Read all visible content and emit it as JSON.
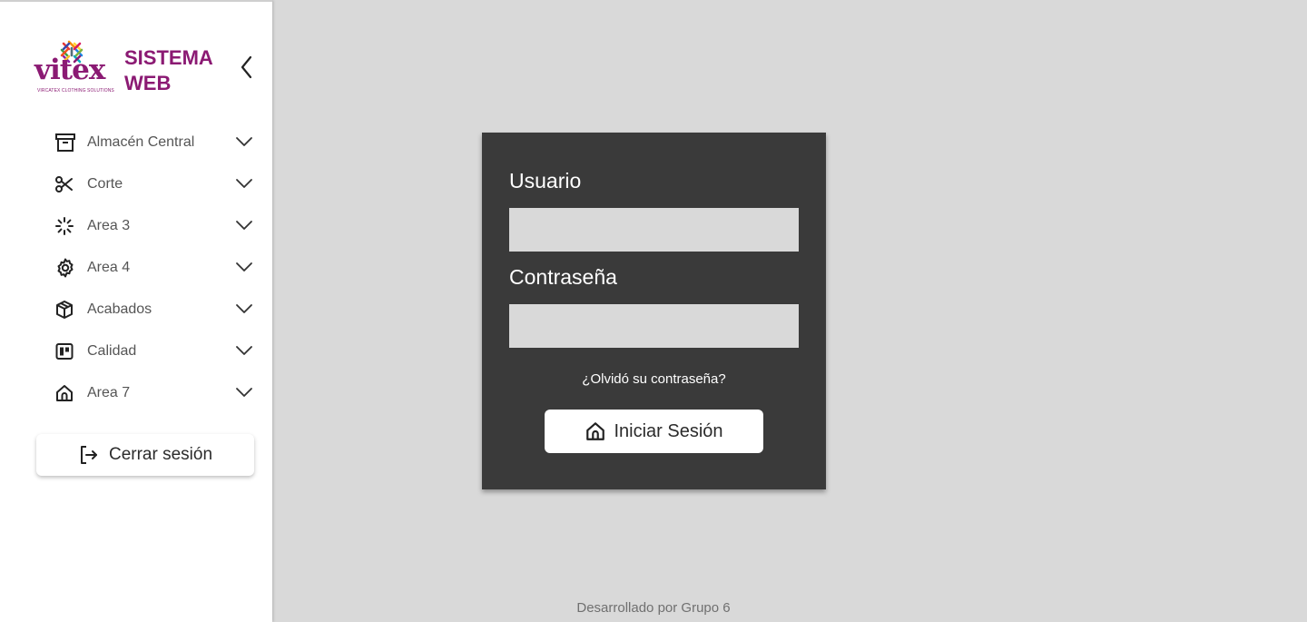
{
  "sidebar": {
    "brand": {
      "word": "vitex",
      "tagline": "VIRCATEX CLOTHING SOLUTIONS"
    },
    "title": "SISTEMA WEB",
    "collapse_icon": "chevron-left-icon",
    "items": [
      {
        "label": "Almacén Central",
        "icon": "archive-icon"
      },
      {
        "label": "Corte",
        "icon": "scissors-icon"
      },
      {
        "label": "Area 3",
        "icon": "loader-icon"
      },
      {
        "label": "Area 4",
        "icon": "gear-icon"
      },
      {
        "label": "Acabados",
        "icon": "package-icon"
      },
      {
        "label": "Calidad",
        "icon": "board-icon"
      },
      {
        "label": "Area 7",
        "icon": "home-icon"
      }
    ],
    "logout_label": "Cerrar sesión"
  },
  "login": {
    "user_label": "Usuario",
    "user_value": "",
    "password_label": "Contraseña",
    "password_value": "",
    "forgot_label": "¿Olvidó su contraseña?",
    "submit_label": "Iniciar Sesión"
  },
  "footer": {
    "text": "Desarrollado por Grupo 6"
  },
  "colors": {
    "brand": "#8b1a73",
    "card": "#3a3a3a",
    "background": "#d9d9d9",
    "input": "#d9d9d9"
  }
}
